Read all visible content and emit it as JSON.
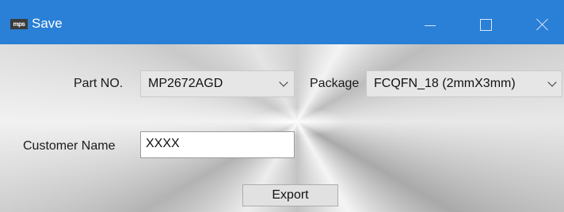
{
  "window": {
    "title": "Save",
    "logo_text": "mps",
    "accent_color": "#2a7fd6",
    "controls": [
      "minimize-icon",
      "maximize-icon",
      "close-icon"
    ]
  },
  "form": {
    "part_no": {
      "label": "Part NO.",
      "value": "MP2672AGD"
    },
    "package": {
      "label": "Package",
      "value": "FCQFN_18 (2mmX3mm)"
    },
    "customer_name": {
      "label": "Customer Name",
      "value": "XXXX"
    },
    "export_label": "Export"
  }
}
